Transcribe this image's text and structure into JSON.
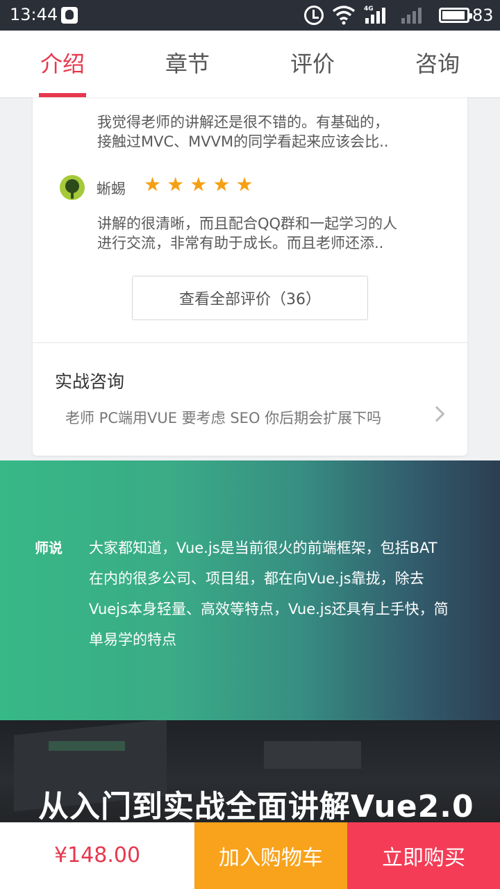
{
  "status_bar": {
    "time": "13:44",
    "network": "4G",
    "battery": "83"
  },
  "tabs": [
    {
      "label": "介绍",
      "active": true
    },
    {
      "label": "章节",
      "active": false
    },
    {
      "label": "评价",
      "active": false
    },
    {
      "label": "咨询",
      "active": false
    }
  ],
  "reviews": [
    {
      "text_lines": [
        "我觉得老师的讲解还是很不错的。有基础的，",
        "接触过MVC、MVVM的同学看起来应该会比.."
      ]
    },
    {
      "user": "蜥蜴",
      "rating": 5,
      "text_lines": [
        "讲解的很清晰，而且配合QQ群和一起学习的人",
        "进行交流，非常有助于成长。而且老师还添.."
      ]
    }
  ],
  "view_all_label": "查看全部评价（36）",
  "consult": {
    "title": "实战咨询",
    "question": "老师 PC端用VUE 要考虑 SEO 你后期会扩展下吗"
  },
  "teacher": {
    "label": "师说",
    "lines": [
      "大家都知道，Vue.js是当前很火的前端框架，包括BAT",
      "在内的很多公司、项目组，都在向Vue.js靠拢，除去",
      "Vuejs本身轻量、高效等特点，Vue.js还具有上手快，简",
      "单易学的特点"
    ]
  },
  "promo": {
    "title": "从入门到实战全面讲解Vue2.0"
  },
  "bottom": {
    "price": "¥148.00",
    "add_to_cart": "加入购物车",
    "buy_now": "立即购买"
  },
  "colors": {
    "accent": "#e6384d",
    "cart": "#f9a21b",
    "buy": "#f43c56",
    "star": "#f5a012"
  }
}
